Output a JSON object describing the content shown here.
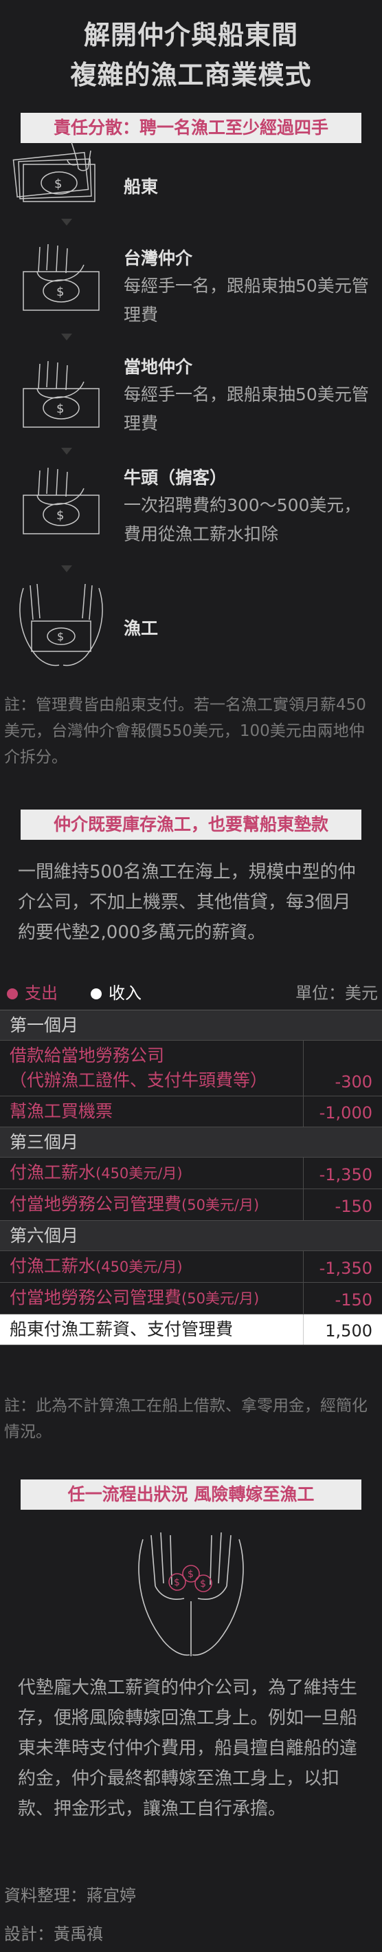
{
  "title": {
    "line1": "解開仲介與船東間",
    "line2": "複雜的漁工商業模式"
  },
  "section1": {
    "banner": "責任分散：聘一名漁工至少經過四手",
    "chain": [
      {
        "name": "船東",
        "desc": ""
      },
      {
        "name": "台灣仲介",
        "desc": "每經手一名，跟船東抽50美元管理費"
      },
      {
        "name": "當地仲介",
        "desc": "每經手一名，跟船東抽50美元管理費"
      },
      {
        "name": "牛頭（掮客）",
        "desc": "一次招聘費約300～500美元，費用從漁工薪水扣除"
      },
      {
        "name": "漁工",
        "desc": ""
      }
    ],
    "note": "註：管理費皆由船東支付。若一名漁工實領月薪450美元，台灣仲介會報價550美元，100美元由兩地仲介拆分。"
  },
  "section2": {
    "banner": "仲介既要庫存漁工，也要幫船東墊款",
    "para": "一間維持500名漁工在海上，規模中型的仲介公司，不加上機票、其他借貸，每3個月約要代墊2,000多萬元的薪資。",
    "legend": {
      "expense": "支出",
      "income": "收入",
      "unit": "單位：美元",
      "expense_color": "#c4446f",
      "income_color": "#ffffff"
    },
    "ledger": {
      "month1": "第一個月",
      "row1_label_a": "借款給當地勞務公司",
      "row1_label_b": "（代辦漁工證件、支付牛頭費等）",
      "row1_amount": "-300",
      "row2_label": "幫漁工買機票",
      "row2_amount": "-1,000",
      "month3": "第三個月",
      "row3_label_a": "付漁工薪水",
      "row3_label_b": "(450美元/月)",
      "row3_amount": "-1,350",
      "row4_label_a": "付當地勞務公司管理費",
      "row4_label_b": "(50美元/月)",
      "row4_amount": "-150",
      "month6": "第六個月",
      "row5_label_a": "付漁工薪水",
      "row5_label_b": "(450美元/月)",
      "row5_amount": "-1,350",
      "row6_label_a": "付當地勞務公司管理費",
      "row6_label_b": "(50美元/月)",
      "row6_amount": "-150",
      "row7_label": "船東付漁工薪資、支付管理費",
      "row7_amount": "1,500"
    },
    "note": "註：此為不計算漁工在船上借款、拿零用金，經簡化情況。"
  },
  "section3": {
    "banner": "任一流程出狀況  風險轉嫁至漁工",
    "para": "代墊龐大漁工薪資的仲介公司，為了維持生存，便將風險轉嫁回漁工身上。例如一旦船東未準時支付仲介費用，船員擅自離船的違約金，仲介最終都轉嫁至漁工身上，以扣款、押金形式，讓漁工自行承擔。"
  },
  "credits": {
    "data": "資料整理：蔣宜婷",
    "design": "設計：黃禹禛"
  }
}
